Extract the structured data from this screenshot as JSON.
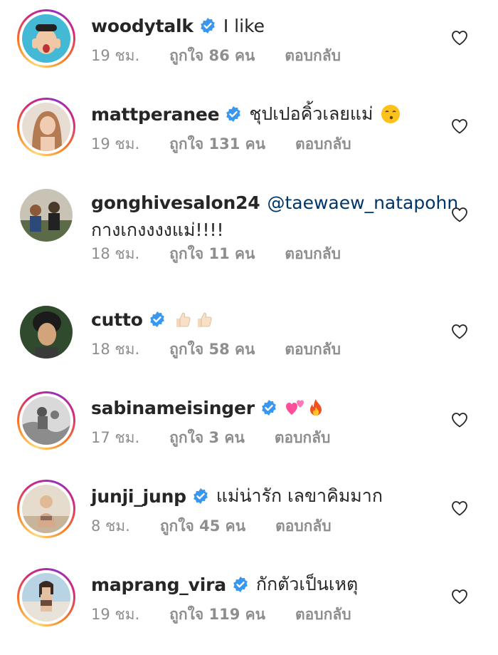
{
  "comments": [
    {
      "username": "woodytalk",
      "verified": true,
      "text": "I like",
      "time": "19 ชม.",
      "likes": "ถูกใจ 86 คน",
      "reply": "ตอบกลับ",
      "ring": true,
      "avatar_color": "#43b9d6"
    },
    {
      "username": "mattperanee",
      "verified": true,
      "text": "ชุปเปอคิ้วเลยแม่",
      "time": "19 ชม.",
      "likes": "ถูกใจ 131 คน",
      "reply": "ตอบกลับ",
      "ring": true,
      "avatar_color": "#c79b7a"
    },
    {
      "username": "gonghivesalon24",
      "verified": false,
      "mention": "@taewaew_natapohn",
      "text2": "กางเกงงงงแม่!!!!",
      "time": "18 ชม.",
      "likes": "ถูกใจ 11 คน",
      "reply": "ตอบกลับ",
      "ring": false,
      "avatar_color": "#6b7a55"
    },
    {
      "username": "cutto",
      "verified": true,
      "text": "",
      "time": "18 ชม.",
      "likes": "ถูกใจ 58 คน",
      "reply": "ตอบกลับ",
      "ring": false,
      "avatar_color": "#3d5a3a"
    },
    {
      "username": "sabinameisinger",
      "verified": true,
      "text": "",
      "time": "17 ชม.",
      "likes": "ถูกใจ 3 คน",
      "reply": "ตอบกลับ",
      "ring": true,
      "avatar_color": "#9a9a9a"
    },
    {
      "username": "junji_junp",
      "verified": true,
      "text": "แม่น่ารัก เลขาคิมมาก",
      "time": "8 ชม.",
      "likes": "ถูกใจ 45 คน",
      "reply": "ตอบกลับ",
      "ring": true,
      "avatar_color": "#c9a88b"
    },
    {
      "username": "maprang_vira",
      "verified": true,
      "text": "กักตัวเป็นเหตุ",
      "time": "19 ชม.",
      "likes": "ถูกใจ 119 คน",
      "reply": "ตอบกลับ",
      "ring": true,
      "avatar_color": "#a8c4d6"
    }
  ],
  "colors": {
    "verified": "#3897f0",
    "meta": "#8e8e8e",
    "mention": "#00376b"
  }
}
